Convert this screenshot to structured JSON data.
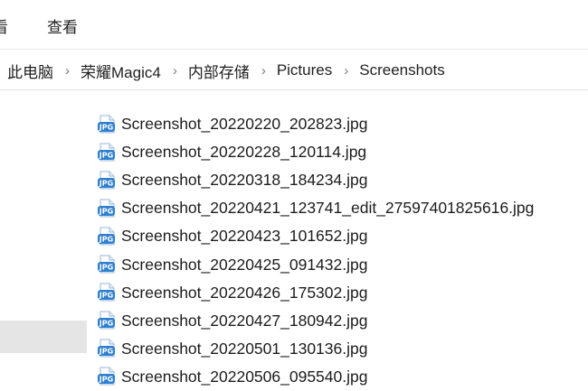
{
  "ribbon": {
    "partial_tab": "看",
    "view_tab": "查看"
  },
  "breadcrumb": [
    "此电脑",
    "荣耀Magic4",
    "内部存储",
    "Pictures",
    "Screenshots"
  ],
  "breadcrumb_separator": "›",
  "files": [
    {
      "name": "Screenshot_20220220_202823.jpg",
      "icon": "jpg-file-icon"
    },
    {
      "name": "Screenshot_20220228_120114.jpg",
      "icon": "jpg-file-icon"
    },
    {
      "name": "Screenshot_20220318_184234.jpg",
      "icon": "jpg-file-icon"
    },
    {
      "name": "Screenshot_20220421_123741_edit_27597401825616.jpg",
      "icon": "jpg-file-icon"
    },
    {
      "name": "Screenshot_20220423_101652.jpg",
      "icon": "jpg-file-icon"
    },
    {
      "name": "Screenshot_20220425_091432.jpg",
      "icon": "jpg-file-icon"
    },
    {
      "name": "Screenshot_20220426_175302.jpg",
      "icon": "jpg-file-icon"
    },
    {
      "name": "Screenshot_20220427_180942.jpg",
      "icon": "jpg-file-icon"
    },
    {
      "name": "Screenshot_20220501_130136.jpg",
      "icon": "jpg-file-icon"
    },
    {
      "name": "Screenshot_20220506_095540.jpg",
      "icon": "jpg-file-icon"
    }
  ],
  "colors": {
    "icon_blue": "#2f7fd0",
    "selection_gray": "#e5e5e5"
  }
}
